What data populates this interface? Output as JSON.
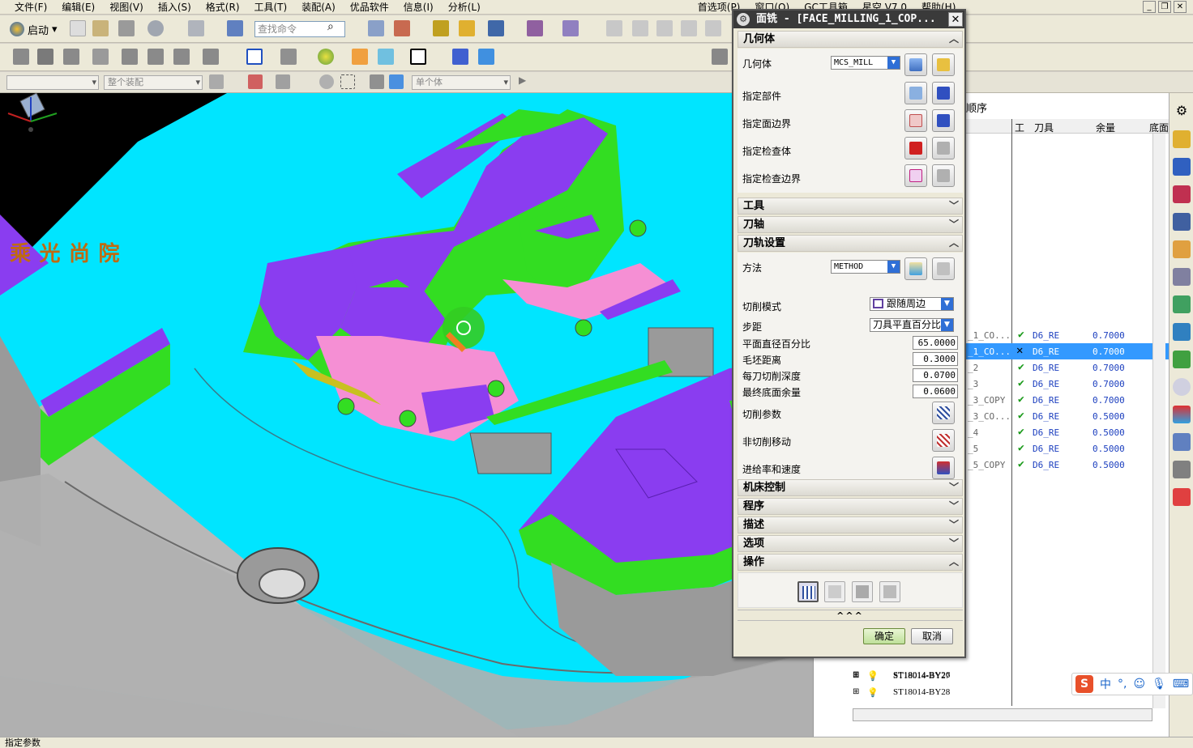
{
  "menubar": {
    "items": [
      "文件(F)",
      "编辑(E)",
      "视图(V)",
      "插入(S)",
      "格式(R)",
      "工具(T)",
      "装配(A)",
      "优品软件",
      "信息(I)",
      "分析(L)",
      "首选项(P)",
      "窗口(O)",
      "GC工具箱",
      "星空 V7.0",
      "帮助(H)"
    ]
  },
  "toolbar": {
    "start_label": "启动",
    "search_placeholder": "查找命令"
  },
  "selection_bar": {
    "combo1": "",
    "combo2": "整个装配",
    "combo3": "单个体"
  },
  "viewport": {
    "logo_text": "乘 光 尚 院"
  },
  "dialog": {
    "title": "面铣 - [FACE_MILLING_1_COP...",
    "sections": {
      "geometry": "几何体",
      "tool": "工具",
      "axis": "刀轴",
      "path_settings": "刀轨设置",
      "machine_control": "机床控制",
      "program": "程序",
      "description": "描述",
      "options": "选项",
      "actions": "操作"
    },
    "geometry": {
      "geometry_label": "几何体",
      "geometry_value": "MCS_MILL",
      "part_label": "指定部件",
      "face_boundary_label": "指定面边界",
      "check_body_label": "指定检查体",
      "check_boundary_label": "指定检查边界"
    },
    "path": {
      "method_label": "方法",
      "method_value": "METHOD",
      "cut_pattern_label": "切削模式",
      "cut_pattern_value": "跟随周边",
      "stepover_label": "步距",
      "stepover_value": "刀具平直百分比",
      "flat_diameter_label": "平面直径百分比",
      "flat_diameter_value": "65.0000",
      "blank_distance_label": "毛坯距离",
      "blank_distance_value": "0.3000",
      "depth_per_cut_label": "每刀切削深度",
      "depth_per_cut_value": "0.0700",
      "final_floor_stock_label": "最终底面余量",
      "final_floor_stock_value": "0.0600",
      "cut_params_label": "切削参数",
      "non_cut_moves_label": "非切削移动",
      "feeds_speeds_label": "进给率和速度"
    },
    "collapse_glyph": "^^^",
    "ok_label": "确定",
    "cancel_label": "取消"
  },
  "navigator": {
    "title": "顺序",
    "headers": [
      "刀具",
      "余量",
      "底面"
    ],
    "rows": [
      {
        "name": "_1_CO...",
        "tool": "D6_RE",
        "stock": "0.7000",
        "status": "ok",
        "selected": false
      },
      {
        "name": "_1_CO...",
        "tool": "D6_RE",
        "stock": "0.7000",
        "status": "bad",
        "selected": true
      },
      {
        "name": "_2",
        "tool": "D6_RE",
        "stock": "0.7000",
        "status": "ok",
        "selected": false
      },
      {
        "name": "_3",
        "tool": "D6_RE",
        "stock": "0.7000",
        "status": "ok",
        "selected": false
      },
      {
        "name": "_3_COPY",
        "tool": "D6_RE",
        "stock": "0.7000",
        "status": "ok",
        "selected": false
      },
      {
        "name": "_3_CO...",
        "tool": "D6_RE",
        "stock": "0.5000",
        "status": "ok",
        "selected": false
      },
      {
        "name": "_4",
        "tool": "D6_RE",
        "stock": "0.5000",
        "status": "ok",
        "selected": false
      },
      {
        "name": "_5",
        "tool": "D6_RE",
        "stock": "0.5000",
        "status": "ok",
        "selected": false
      },
      {
        "name": "_5_COPY",
        "tool": "D6_RE",
        "stock": "0.5000",
        "status": "ok",
        "selected": false
      }
    ],
    "tree": [
      "ST18014-BY26",
      "ST18014-BY27",
      "ST18014-BY28"
    ]
  },
  "ime": {
    "lang": "中",
    "punct": "°,"
  },
  "status": {
    "text": "指定参数"
  },
  "colors": {
    "viewport_bg": "#00e5ff",
    "part_purple": "#8a3df0",
    "part_green": "#33dd22",
    "part_pink": "#f58fd4",
    "part_grey": "#b9b9b9",
    "selection_blue": "#3399ff"
  }
}
